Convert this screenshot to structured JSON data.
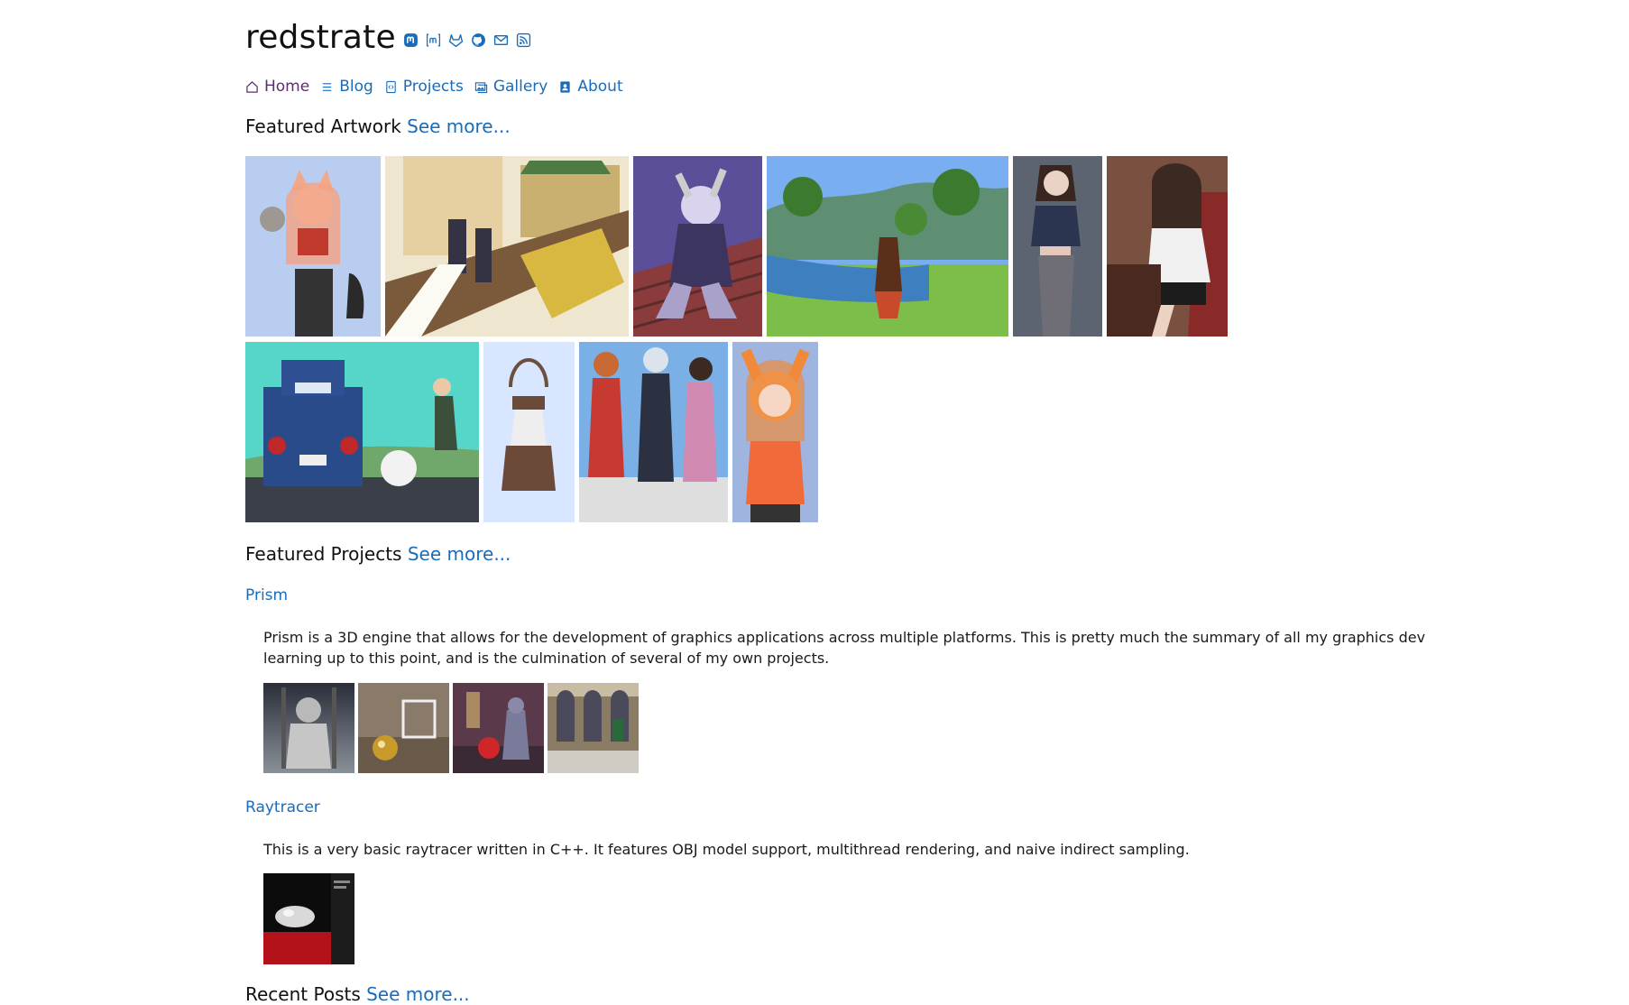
{
  "site": {
    "title": "redstrate",
    "social_icons": [
      "mastodon-icon",
      "matrix-icon",
      "gitlab-icon",
      "github-icon",
      "mail-icon",
      "rss-icon"
    ]
  },
  "nav": {
    "items": [
      {
        "label": "Home",
        "icon": "home-icon"
      },
      {
        "label": "Blog",
        "icon": "list-icon"
      },
      {
        "label": "Projects",
        "icon": "code-file-icon"
      },
      {
        "label": "Gallery",
        "icon": "image-icon"
      },
      {
        "label": "About",
        "icon": "contact-icon"
      }
    ]
  },
  "featured_artwork": {
    "heading": "Featured Artwork",
    "see_more": "See more..."
  },
  "featured_projects": {
    "heading": "Featured Projects",
    "see_more": "See more...",
    "projects": [
      {
        "title": "Prism",
        "description": "Prism is a 3D engine that allows for the development of graphics applications across multiple platforms. This is pretty much the summary of all my graphics dev learning up to this point, and is the culmination of several of my own projects."
      },
      {
        "title": "Raytracer",
        "description": "This is a very basic raytracer written in C++. It features OBJ model support, multithread rendering, and naive indirect sampling."
      }
    ]
  },
  "recent_posts": {
    "heading": "Recent Posts",
    "see_more": "See more..."
  },
  "colors": {
    "link": "#1a6cb8",
    "current_nav": "#5a2f6e",
    "text": "#1a1a1a"
  }
}
